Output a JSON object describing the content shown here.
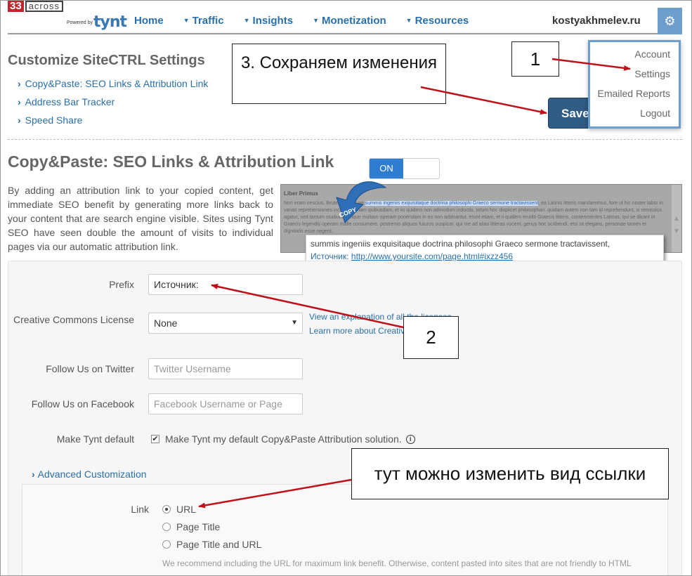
{
  "header": {
    "logo_33": "33",
    "logo_across": "across",
    "logo_powered": "Powered by",
    "logo_tynt": "tynt",
    "nav": [
      "Home",
      "Traffic",
      "Insights",
      "Monetization",
      "Resources"
    ],
    "user": "kostyakhmelev.ru",
    "gear_icon": "gear-icon"
  },
  "dropdown": {
    "items": [
      "Account",
      "Settings",
      "Emailed Reports",
      "Logout"
    ]
  },
  "page": {
    "title": "Customize SiteCTRL Settings",
    "toc": [
      "Copy&Paste: SEO Links & Attribution Link",
      "Address Bar Tracker",
      "Speed Share"
    ],
    "save_label": "Save"
  },
  "section": {
    "title": "Copy&Paste: SEO Links & Attribution Link",
    "toggle_label": "ON",
    "description": "By adding an attribution link to your copied content, get immediate SEO benefit by generating more links back to your content that are search engine visible. Sites using Tynt SEO have seen double the amount of visits to individual pages via our automatic attribution link."
  },
  "preview": {
    "heading": "Liber Primus",
    "text_before": "Non eram nescius, Brute, cum, quae ",
    "text_highlight": "summis ingeniis exquisitaque doctrina philosophi Graeco sermone tractavissent",
    "text_after": ", ea Latinis litteris mandaremus, fore ut hic noster labor in varias reprehensiones incurreret. nam quibusdam, et iis quidem non admodum indoctis, totum hoc displicet philosophari. quidam autem non tam id reprehendunt, si remissius agatur, sed tantum studium tamque multam operam ponendam in eo non arbitrantur. erunt etiam, et ii quidem eruditi Graecis litteris, contemnentes Latinas, qui se dicant in Graecis legendis operam malle consumere. postremo aliquos futuros suspicor, qui me ad alias litteras vocent, genus hoc scribendi, etsi sit elegans, personae tamen et dignitatis esse negent.",
    "copy_label": "COPY",
    "paste_line": "summis ingeniis exquisitaque doctrina philosophi Graeco sermone tractavissent,",
    "paste_source_label": "Источник:",
    "paste_link": "http://www.yoursite.com/page.html#ixzz456"
  },
  "form": {
    "prefix_label": "Prefix",
    "prefix_value": "Источник:",
    "cc_label": "Creative Commons License",
    "cc_value": "None",
    "cc_help_1": "View an explanation of all the licenses",
    "cc_help_2": "Learn more about Creative Commons",
    "twitter_label": "Follow Us on Twitter",
    "twitter_placeholder": "Twitter Username",
    "facebook_label": "Follow Us on Facebook",
    "facebook_placeholder": "Facebook Username or Page",
    "default_label": "Make Tynt default",
    "default_checkbox": "Make Tynt my default Copy&Paste Attribution solution.",
    "advanced_label": "Advanced Customization",
    "link_label": "Link",
    "link_options": [
      "URL",
      "Page Title",
      "Page Title and URL"
    ],
    "link_selected": "URL",
    "note": "We recommend including the URL for maximum link benefit. Otherwise, content pasted into sites that are not friendly to HTML formatting (e.g. Facebook) will not include a clickable link or the URL."
  },
  "annotations": {
    "callout_3": "3. Сохраняем изменения",
    "callout_1": "1",
    "callout_2": "2",
    "callout_4": "тут можно изменить вид ссылки",
    "arrow_color": "#c0101a"
  }
}
